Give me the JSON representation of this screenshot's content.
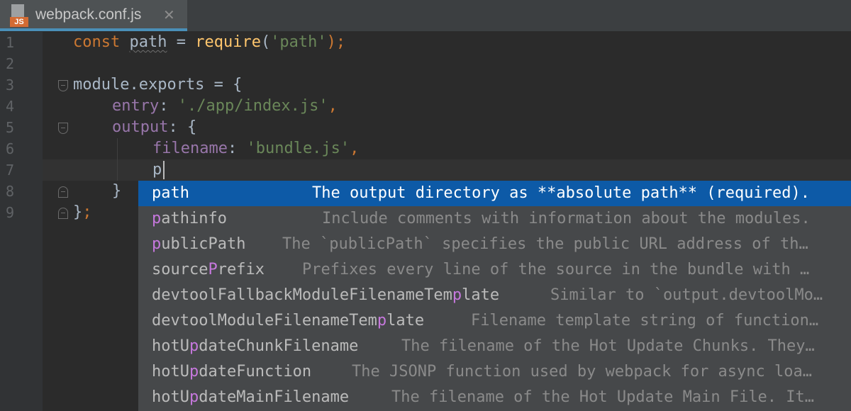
{
  "tab": {
    "title": "webpack.conf.js",
    "icon_badge": "JS",
    "close_glyph": "✕"
  },
  "gutter": {
    "line_numbers": [
      "1",
      "2",
      "3",
      "4",
      "5",
      "6",
      "7",
      "8",
      "9"
    ]
  },
  "code": {
    "line1": {
      "kw": "const",
      "var": "path",
      "eq": " = ",
      "fn": "require",
      "open": "(",
      "str": "'path'",
      "close": ");"
    },
    "line3": {
      "text": "module.exports = {"
    },
    "line4": {
      "prop": "entry",
      "colon": ": ",
      "str": "'./app/index.js'",
      "comma": ","
    },
    "line5": {
      "prop": "output",
      "rest": ": {"
    },
    "line6": {
      "prop": "filename",
      "colon": ": ",
      "str": "'bundle.js'",
      "comma": ","
    },
    "line7": {
      "typed": "p"
    },
    "line8": {
      "text": "}"
    },
    "line9": {
      "brace": "}",
      "semi": ";"
    }
  },
  "completion": {
    "items": [
      {
        "pre": "",
        "hl": "p",
        "post": "ath",
        "desc": "The output directory as **absolute path** (required).",
        "selected": true
      },
      {
        "pre": "",
        "hl": "p",
        "post": "athinfo",
        "desc": "Include comments with information about the modules."
      },
      {
        "pre": "",
        "hl": "p",
        "post": "ublicPath",
        "desc": "The `publicPath` specifies the public URL address of th…"
      },
      {
        "pre": "source",
        "hl": "P",
        "post": "refix",
        "desc": "Prefixes every line of the source in the bundle with …"
      },
      {
        "pre": "devtoolFallbackModuleFilenameTem",
        "hl": "p",
        "post": "late",
        "desc": "Similar to `output.devtoolMo…"
      },
      {
        "pre": "devtoolModuleFilenameTem",
        "hl": "p",
        "post": "late",
        "desc": "Filename template string of function…"
      },
      {
        "pre": "hotU",
        "hl": "p",
        "post": "dateChunkFilename",
        "desc": "The filename of the Hot Update Chunks. They…"
      },
      {
        "pre": "hotU",
        "hl": "p",
        "post": "dateFunction",
        "desc": "The JSONP function used by webpack for async loa…"
      },
      {
        "pre": "hotU",
        "hl": "p",
        "post": "dateMainFilename",
        "desc": "The filename of the Hot Update Main File. It…"
      }
    ]
  },
  "colors": {
    "keyword": "#cc7832",
    "function": "#ffc66d",
    "string": "#6a8759",
    "property": "#9876aa",
    "selection": "#0d5aa7",
    "match": "#c678dd"
  }
}
